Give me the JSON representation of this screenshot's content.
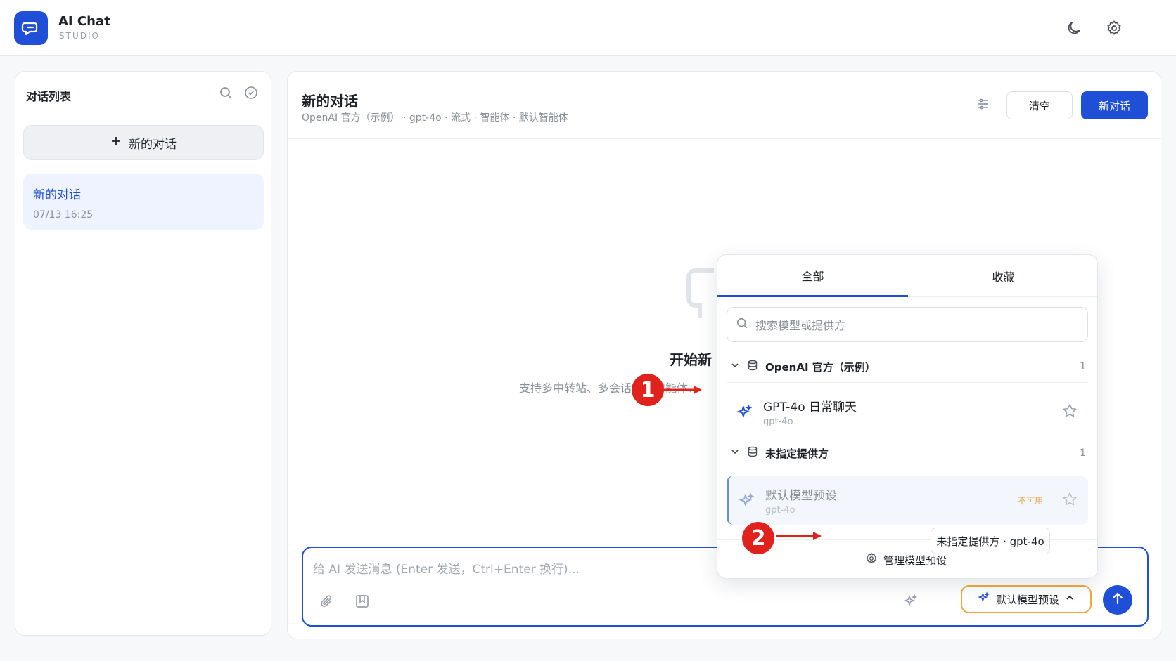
{
  "app": {
    "title": "AI Chat",
    "subtitle": "STUDIO"
  },
  "header": {
    "theme_icon": "moon-icon",
    "settings_icon": "gear-icon"
  },
  "sidebar": {
    "title": "对话列表",
    "new_chat_label": "新的对话",
    "conversations": [
      {
        "title": "新的对话",
        "time": "07/13 16:25"
      }
    ]
  },
  "chat": {
    "title": "新的对话",
    "meta": "OpenAI 官方（示例） · gpt-4o · 流式 · 智能体 · 默认智能体",
    "clear_label": "清空",
    "new_label": "新对话",
    "empty_title": "开始新",
    "empty_sub": "支持多中转站、多会话、多智能体、"
  },
  "composer": {
    "placeholder": "给 AI 发送消息 (Enter 发送，Ctrl+Enter 换行)...",
    "model_button": "默认模型预设"
  },
  "dropdown": {
    "tabs": [
      "全部",
      "收藏"
    ],
    "search_placeholder": "搜索模型或提供方",
    "groups": [
      {
        "name": "OpenAI 官方（示例）",
        "count": "1",
        "items": [
          {
            "name": "GPT-4o 日常聊天",
            "id": "gpt-4o",
            "badge": ""
          }
        ]
      },
      {
        "name": "未指定提供方",
        "count": "1",
        "items": [
          {
            "name": "默认模型预设",
            "id": "gpt-4o",
            "badge": "不可用"
          }
        ]
      }
    ],
    "manage_label": "管理模型预设"
  },
  "tooltip": "未指定提供方 · gpt-4o",
  "annotations": [
    "1",
    "2"
  ],
  "colors": {
    "accent": "#1f4fd6",
    "callout": "#e0211c",
    "warning": "#e8a33b"
  }
}
